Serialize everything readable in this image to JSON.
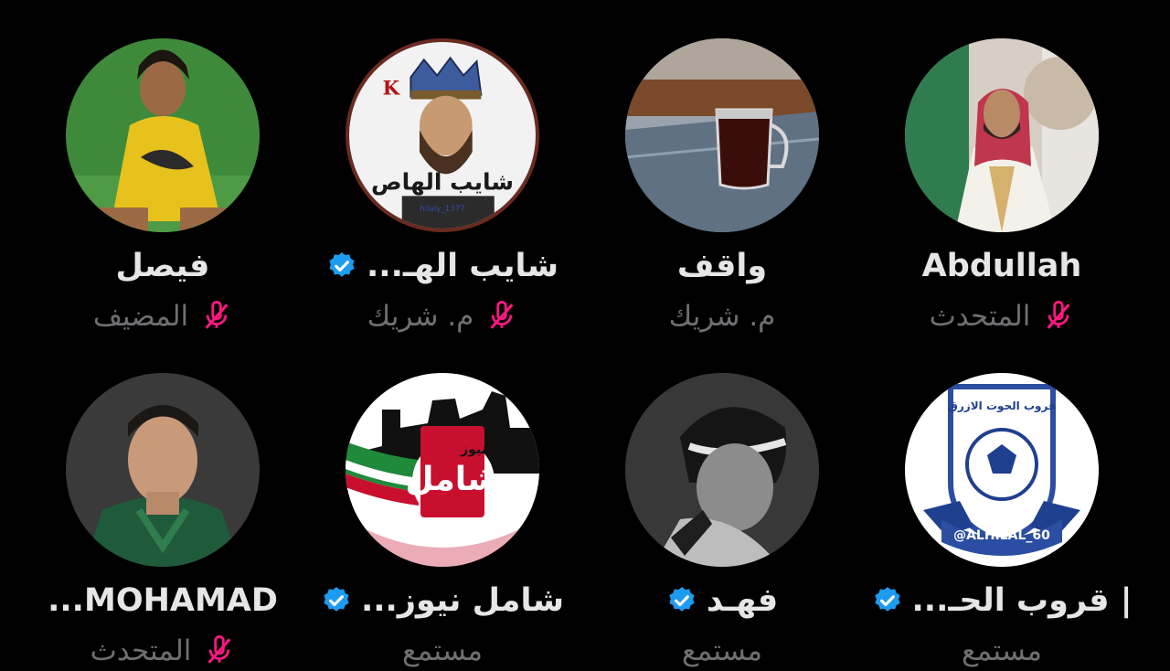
{
  "participants": [
    {
      "name": "Abdullah",
      "role": "المتحدث",
      "verified": false,
      "muted": true
    },
    {
      "name": "واقف",
      "role": "م. شريك",
      "verified": false,
      "muted": false
    },
    {
      "name": "شايب الهـ...",
      "role": "م. شريك",
      "verified": true,
      "muted": true,
      "avatar_text": "شايب الهاص",
      "avatar_handle": "hilaly_1377",
      "avatar_letter": "K"
    },
    {
      "name": "فيصل",
      "role": "المضيف",
      "verified": false,
      "muted": true
    },
    {
      "name": "| قروب الحـ...",
      "role": "مستمع",
      "verified": true,
      "muted": false,
      "avatar_text": "@ALHILAL_60",
      "avatar_title": "قروب الحوت الازرق"
    },
    {
      "name": "فهـد",
      "role": "مستمع",
      "verified": true,
      "muted": false
    },
    {
      "name": "شامل نيوز...",
      "role": "مستمع",
      "verified": true,
      "muted": false,
      "avatar_text": "شامل",
      "avatar_sub": "نيوز"
    },
    {
      "name": "MOHAMAD...",
      "role": "المتحدث",
      "verified": false,
      "muted": true
    }
  ],
  "colors": {
    "verified": "#1d9bf0",
    "muted_mic": "#f91880",
    "role_text": "#6f6f73",
    "background": "#000000"
  }
}
